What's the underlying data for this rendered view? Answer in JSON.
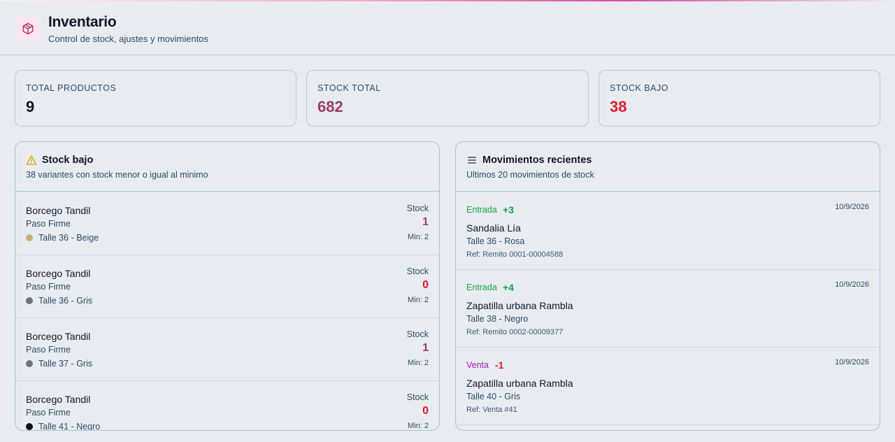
{
  "header": {
    "title": "Inventario",
    "subtitle": "Control de stock, ajustes y movimientos",
    "icon": "package-icon"
  },
  "stats": [
    {
      "label": "TOTAL PRODUCTOS",
      "value": "9",
      "color": "#0f172a"
    },
    {
      "label": "STOCK TOTAL",
      "value": "682",
      "color": "#9d3b6a"
    },
    {
      "label": "STOCK BAJO",
      "value": "38",
      "color": "#dc1a2e"
    }
  ],
  "low_stock": {
    "title": "Stock bajo",
    "subtitle": "38 variantes con stock menor o igual al minimo",
    "icon": "warning-icon",
    "items": [
      {
        "name": "Borcego Tandil",
        "brand": "Paso Firme",
        "variant": "Talle 36 - Beige",
        "dot_color": "#c9b07a",
        "stock_label": "Stock",
        "stock": "1",
        "stock_color": "#9d3b6a",
        "min": "Min: 2"
      },
      {
        "name": "Borcego Tandil",
        "brand": "Paso Firme",
        "variant": "Talle 36 - Gris",
        "dot_color": "#6b7280",
        "stock_label": "Stock",
        "stock": "0",
        "stock_color": "#dc1a2e",
        "min": "Min: 2"
      },
      {
        "name": "Borcego Tandil",
        "brand": "Paso Firme",
        "variant": "Talle 37 - Gris",
        "dot_color": "#6b7280",
        "stock_label": "Stock",
        "stock": "1",
        "stock_color": "#9d3b6a",
        "min": "Min: 2"
      },
      {
        "name": "Borcego Tandil",
        "brand": "Paso Firme",
        "variant": "Talle 41 - Negro",
        "dot_color": "#111111",
        "stock_label": "Stock",
        "stock": "0",
        "stock_color": "#dc1a2e",
        "min": "Min: 2"
      }
    ]
  },
  "movements": {
    "title": "Movimientos recientes",
    "subtitle": "Ultimos 20 movimientos de stock",
    "icon": "list-icon",
    "items": [
      {
        "type": "Entrada",
        "type_color": "#16a34a",
        "qty": "+3",
        "qty_color": "#16a34a",
        "date": "10/9/2026",
        "name": "Sandalia Lía",
        "variant": "Talle 36 - Rosa",
        "ref": "Ref: Remito 0001-00004588"
      },
      {
        "type": "Entrada",
        "type_color": "#16a34a",
        "qty": "+4",
        "qty_color": "#16a34a",
        "date": "10/9/2026",
        "name": "Zapatilla urbana Rambla",
        "variant": "Talle 38 - Negro",
        "ref": "Ref: Remito 0002-00009377"
      },
      {
        "type": "Venta",
        "type_color": "#a21caf",
        "qty": "-1",
        "qty_color": "#dc1a2e",
        "date": "10/9/2026",
        "name": "Zapatilla urbana Rambla",
        "variant": "Talle 40 - Gris",
        "ref": "Ref: Venta #41"
      }
    ]
  }
}
